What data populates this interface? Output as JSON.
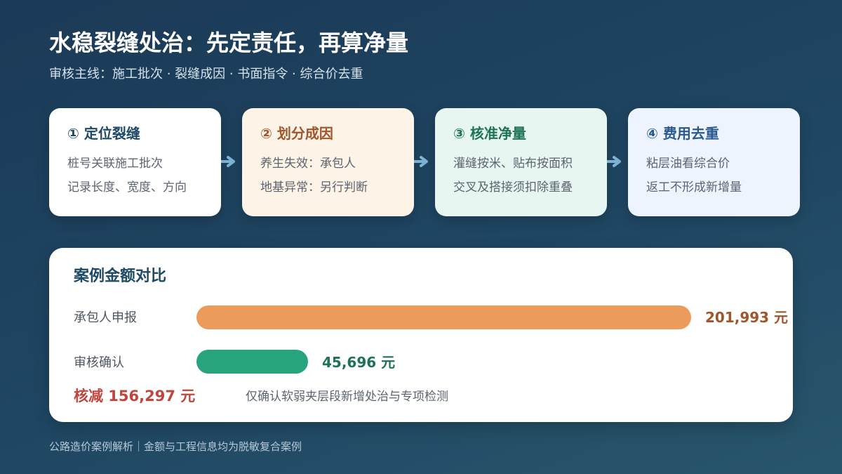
{
  "title": "水稳裂缝处治：先定责任，再算净量",
  "subtitle": "审核主线：施工批次 · 裂缝成因 · 书面指令 · 综合价去重",
  "steps": [
    {
      "title": "① 定位裂缝",
      "lines": [
        "桩号关联施工批次",
        "记录长度、宽度、方向"
      ],
      "bg": "#ffffff",
      "title_color": "#1f4a66"
    },
    {
      "title": "② 划分成因",
      "lines": [
        "养生失效：承包人",
        "地基异常：另行判断"
      ],
      "bg": "#fdf3e7",
      "title_color": "#a0562a"
    },
    {
      "title": "③ 核准净量",
      "lines": [
        "灌缝按米、贴布按面积",
        "交叉及搭接须扣除重叠"
      ],
      "bg": "#e8f6f1",
      "title_color": "#1d7258"
    },
    {
      "title": "④ 费用去重",
      "lines": [
        "粘层油看综合价",
        "返工不形成新增量"
      ],
      "bg": "#eef4fd",
      "title_color": "#2a5a8c"
    }
  ],
  "arrow_color": "#7cb3d3",
  "comparison": {
    "title": "案例金额对比",
    "rows": [
      {
        "label": "承包人申报",
        "amount": 201993,
        "value_text": "201,993 元",
        "color": "#ec9b5a",
        "value_color": "#a0562a"
      },
      {
        "label": "审核确认",
        "amount": 45696,
        "value_text": "45,696 元",
        "color": "#27a37d",
        "value_color": "#1d7258"
      }
    ],
    "reduction_text": "核减 156,297 元",
    "note": "仅确认软弱夹层段新增处治与专项检测"
  },
  "footer": "公路造价案例解析｜金额与工程信息均为脱敏复合案例"
}
